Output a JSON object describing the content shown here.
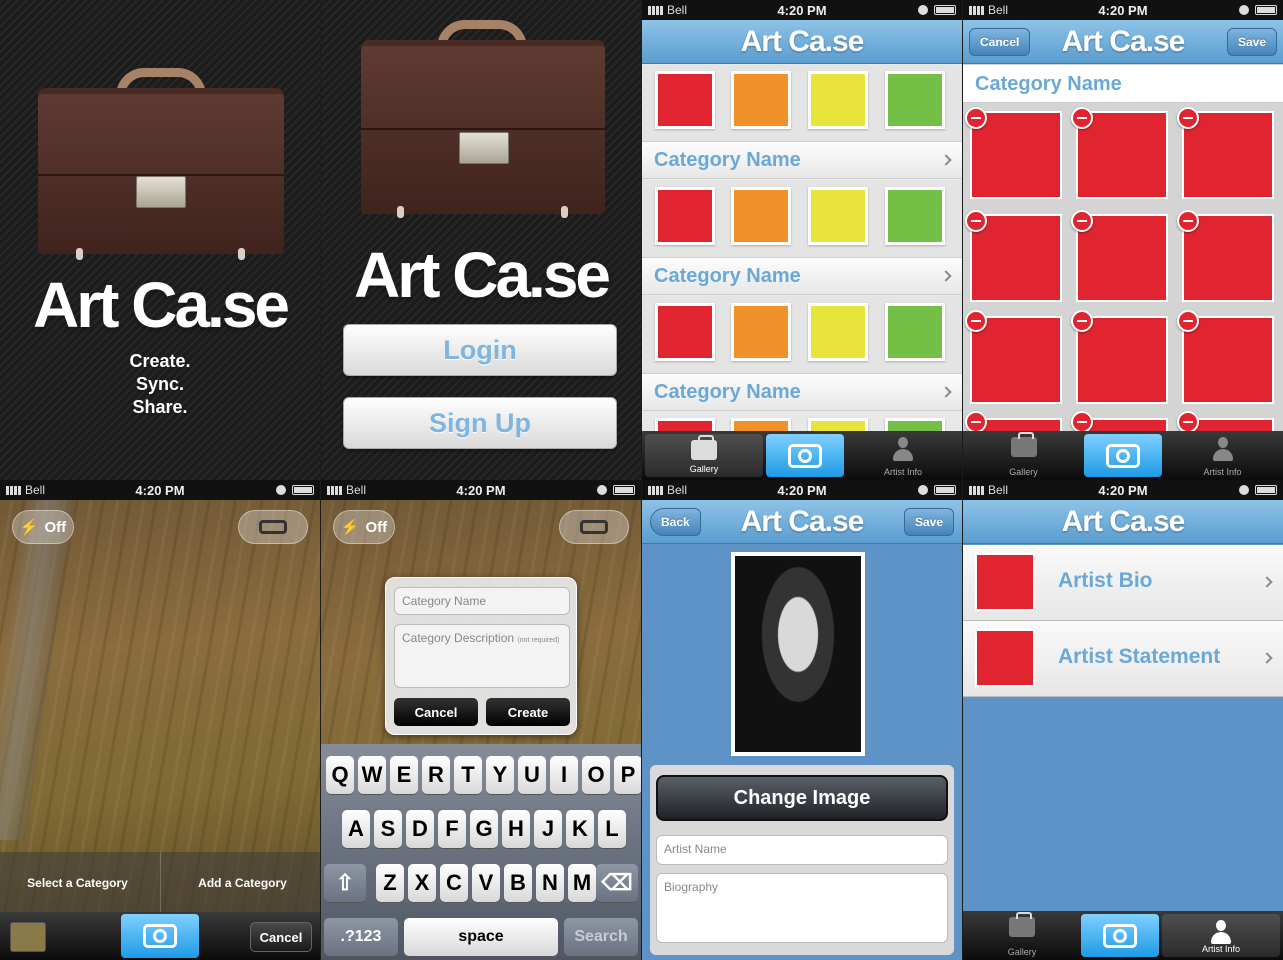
{
  "status": {
    "carrier": "Bell",
    "time": "4:20 PM"
  },
  "app": {
    "title": "Art Ca.se"
  },
  "splash": {
    "title": "Art Ca.se",
    "taglines": [
      "Create.",
      "Sync.",
      "Share."
    ]
  },
  "login": {
    "title": "Art Ca.se",
    "login_label": "Login",
    "signup_label": "Sign Up"
  },
  "gallery": {
    "categories": [
      "Category Name",
      "Category Name",
      "Category Name"
    ],
    "colors": {
      "red": "#e02530",
      "orange": "#f0912a",
      "yellow": "#e9e43c",
      "green": "#74bf46"
    }
  },
  "edit": {
    "cancel": "Cancel",
    "save": "Save",
    "category": "Category Name"
  },
  "tabs": {
    "gallery": "Gallery",
    "artist_info": "Artist Info"
  },
  "camera": {
    "flash": "Off",
    "select_category": "Select a Category",
    "add_category": "Add a Category",
    "cancel": "Cancel"
  },
  "newcat": {
    "name_placeholder": "Category Name",
    "desc_placeholder": "Category Description",
    "desc_hint": "(not required)",
    "cancel": "Cancel",
    "create": "Create"
  },
  "keyboard": {
    "row1": [
      "Q",
      "W",
      "E",
      "R",
      "T",
      "Y",
      "U",
      "I",
      "O",
      "P"
    ],
    "row2": [
      "A",
      "S",
      "D",
      "F",
      "G",
      "H",
      "J",
      "K",
      "L"
    ],
    "row3": [
      "Z",
      "X",
      "C",
      "V",
      "B",
      "N",
      "M"
    ],
    "numbers": ".?123",
    "space": "space",
    "search": "Search"
  },
  "profile": {
    "back": "Back",
    "save": "Save",
    "change_image": "Change Image",
    "name_placeholder": "Artist Name",
    "bio_placeholder": "Biography"
  },
  "artist_menu": {
    "items": [
      "Artist Bio",
      "Artist Statement"
    ]
  }
}
